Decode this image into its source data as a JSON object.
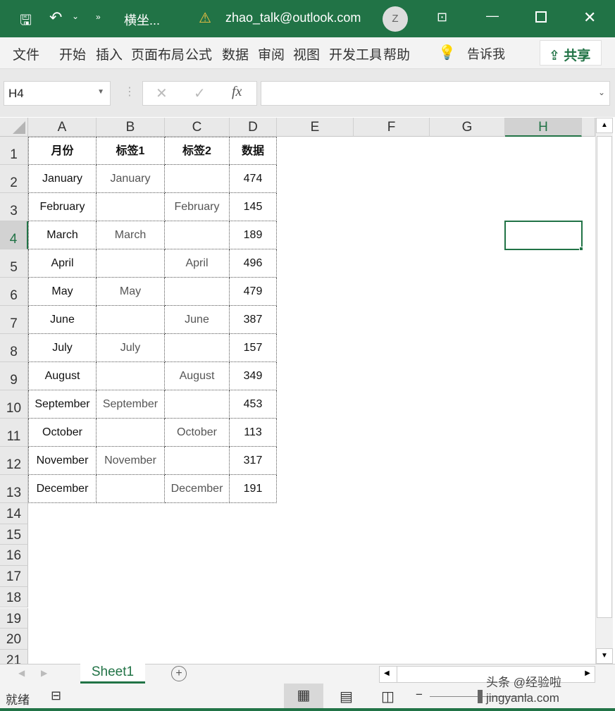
{
  "titlebar": {
    "doc_title": "横坐...",
    "account": "zhao_talk@outlook.com",
    "avatar": "Z",
    "color": "#217346"
  },
  "ribbon": {
    "tabs": [
      "文件",
      "开始",
      "插入",
      "页面布局",
      "公式",
      "数据",
      "审阅",
      "视图",
      "开发工具",
      "帮助"
    ],
    "tell_me": "告诉我",
    "share": "共享"
  },
  "formula": {
    "name_box": "H4",
    "value": ""
  },
  "columns": [
    "A",
    "B",
    "C",
    "D",
    "E",
    "F",
    "G",
    "H"
  ],
  "row_numbers": [
    "1",
    "2",
    "3",
    "4",
    "5",
    "6",
    "7",
    "8",
    "9",
    "10",
    "11",
    "12",
    "13",
    "14",
    "15",
    "16",
    "17",
    "18",
    "19",
    "20",
    "21"
  ],
  "table": {
    "headers": [
      "月份",
      "标签1",
      "标签2",
      "数据"
    ],
    "rows": [
      [
        "January",
        "January",
        "",
        "474"
      ],
      [
        "February",
        "",
        "February",
        "145"
      ],
      [
        "March",
        "March",
        "",
        "189"
      ],
      [
        "April",
        "",
        "April",
        "496"
      ],
      [
        "May",
        "May",
        "",
        "479"
      ],
      [
        "June",
        "",
        "June",
        "387"
      ],
      [
        "July",
        "July",
        "",
        "157"
      ],
      [
        "August",
        "",
        "August",
        "349"
      ],
      [
        "September",
        "September",
        "",
        "453"
      ],
      [
        "October",
        "",
        "October",
        "113"
      ],
      [
        "November",
        "November",
        "",
        "317"
      ],
      [
        "December",
        "",
        "December",
        "191"
      ]
    ]
  },
  "selected_cell": "H4",
  "sheets": [
    "Sheet1"
  ],
  "status": {
    "ready": "就绪"
  },
  "watermark": "头条 @经验啦 jingyanla.com"
}
